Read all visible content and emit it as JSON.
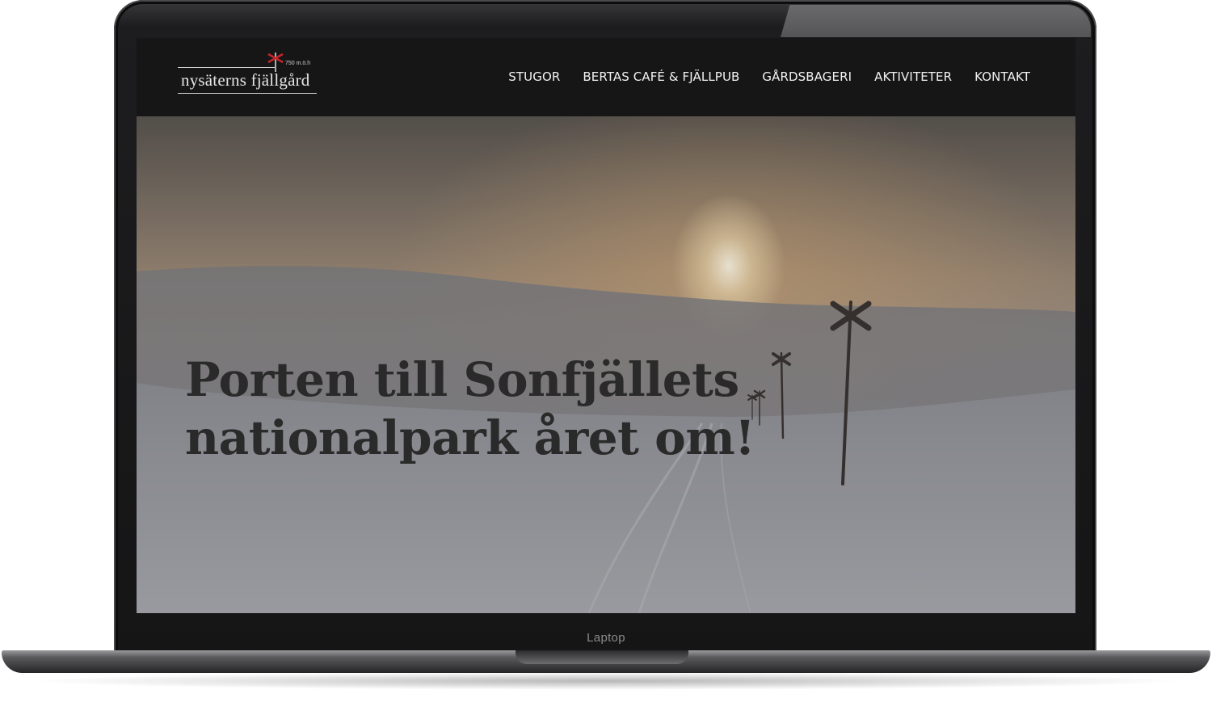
{
  "site": {
    "logo": {
      "name": "nysäterns fjällgård",
      "altitude": "750 m.ö.h"
    },
    "nav": [
      {
        "label": "STUGOR"
      },
      {
        "label": "BERTAS CAFÉ & FJÄLLPUB"
      },
      {
        "label": "GÅRDSBAGERI"
      },
      {
        "label": "AKTIVITETER"
      },
      {
        "label": "KONTAKT"
      }
    ],
    "hero": {
      "line1": "Porten till Sonfjällets",
      "line2": "nationalpark året om!"
    }
  },
  "device": {
    "label": "Laptop"
  },
  "colors": {
    "header_bg": "#161616",
    "logo_accent": "#c8242b",
    "hero_text": "#2a2a2a"
  }
}
